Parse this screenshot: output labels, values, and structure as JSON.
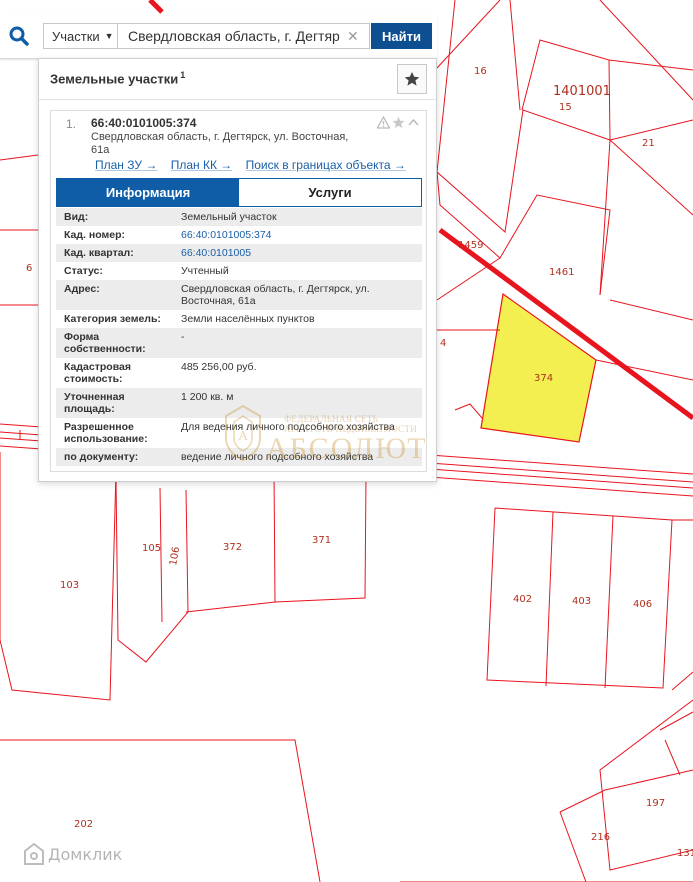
{
  "search": {
    "type_label": "Участки",
    "query": "Свердловская область, г. Дегтяр",
    "find_label": "Найти"
  },
  "panel": {
    "title": "Земельные участки",
    "count": "1"
  },
  "card": {
    "number": "1.",
    "cad_id": "66:40:0101005:374",
    "address": "Свердловская область, г. Дегтярск, ул. Восточная, 61а",
    "links": [
      "План ЗУ →",
      "План КК →",
      "Поиск в границах объекта →"
    ],
    "tabs": [
      "Информация",
      "Услуги"
    ]
  },
  "properties": [
    {
      "key": "Вид:",
      "value": "Земельный участок"
    },
    {
      "key": "Кад. номер:",
      "value": "66:40:0101005:374",
      "link": true
    },
    {
      "key": "Кад. квартал:",
      "value": "66:40:0101005",
      "link": true
    },
    {
      "key": "Статус:",
      "value": "Учтенный"
    },
    {
      "key": "Адрес:",
      "value": "Свердловская область, г. Дегтярск, ул. Восточная, 61а"
    },
    {
      "key": "Категория земель:",
      "value": "Земли населённых пунктов"
    },
    {
      "key": "Форма собственности:",
      "value": "-"
    },
    {
      "key": "Кадастровая стоимость:",
      "value": "485 256,00 руб."
    },
    {
      "key": "Уточненная площадь:",
      "value": "1 200 кв. м"
    },
    {
      "key": "Разрешенное использование:",
      "value": "Для ведения личного подсобного хозяйства"
    },
    {
      "key": "по документу:",
      "value": "ведение личного подсобного хозяйства"
    }
  ],
  "map_labels": [
    "16",
    "1401001",
    "15",
    "21",
    "1459",
    "1461",
    "374",
    "6",
    "4",
    "105",
    "106",
    "372",
    "371",
    "103",
    "402",
    "403",
    "406",
    "202",
    "197",
    "216",
    "131"
  ],
  "watermark": {
    "top_text": "ФЕДЕРАЛЬНАЯ СЕТЬ",
    "mid_text": "АГЕНТСТВ НЕДВИЖИМОСТИ",
    "big_text": "АБСОЛЮТ"
  },
  "logo_text": "Домклик",
  "colors": {
    "parcel_line": "#e8141e",
    "highlight_fill": "#f4ef50",
    "accent": "#0e5da6",
    "button": "#0e4f91"
  }
}
